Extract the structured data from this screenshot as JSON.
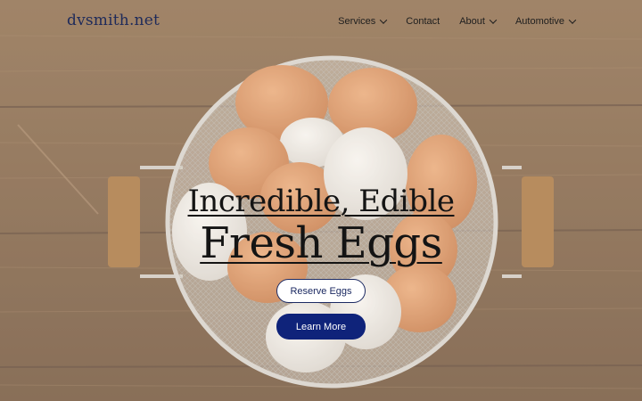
{
  "header": {
    "logo": "dvsmith.net",
    "nav": [
      {
        "label": "Services",
        "has_dropdown": true
      },
      {
        "label": "Contact",
        "has_dropdown": false
      },
      {
        "label": "About",
        "has_dropdown": true
      },
      {
        "label": "Automotive",
        "has_dropdown": true
      }
    ]
  },
  "hero": {
    "title_line1": "Incredible, Edible",
    "title_line2": "Fresh Eggs",
    "buttons": {
      "reserve_label": "Reserve Eggs",
      "learn_label": "Learn More"
    }
  },
  "colors": {
    "brand_navy": "#0f237a",
    "logo_color": "#1e2a5a"
  }
}
